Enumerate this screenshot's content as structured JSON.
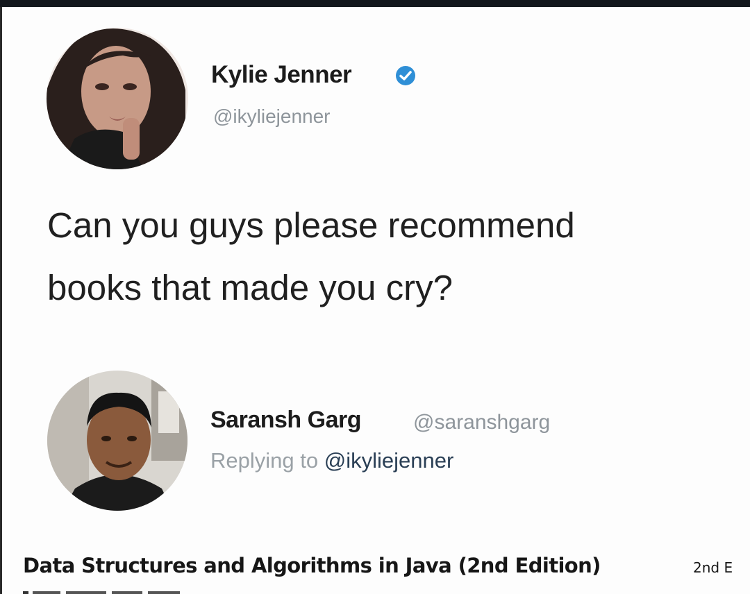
{
  "original_tweet": {
    "author_name": "Kylie Jenner",
    "author_handle": "@ikyliejenner",
    "verified": true,
    "text_lines": [
      "Can you guys please recommend",
      "books that made you cry?"
    ]
  },
  "reply_tweet": {
    "author_name": "Saransh Garg",
    "author_handle": "@saranshgarg",
    "replying_prefix": "Replying to",
    "replying_to_handle": "@ikyliejenner"
  },
  "book_listing": {
    "title": "Data Structures and Algorithms in Java (2nd Edition)",
    "edition_snippet": "2nd E"
  },
  "colors": {
    "verified_badge": "#2f8fd6",
    "handle_text": "#8e959b",
    "mention_text": "#2a3f55",
    "top_bar": "#13171c"
  },
  "icons": {
    "verified": "verified-badge-icon"
  }
}
